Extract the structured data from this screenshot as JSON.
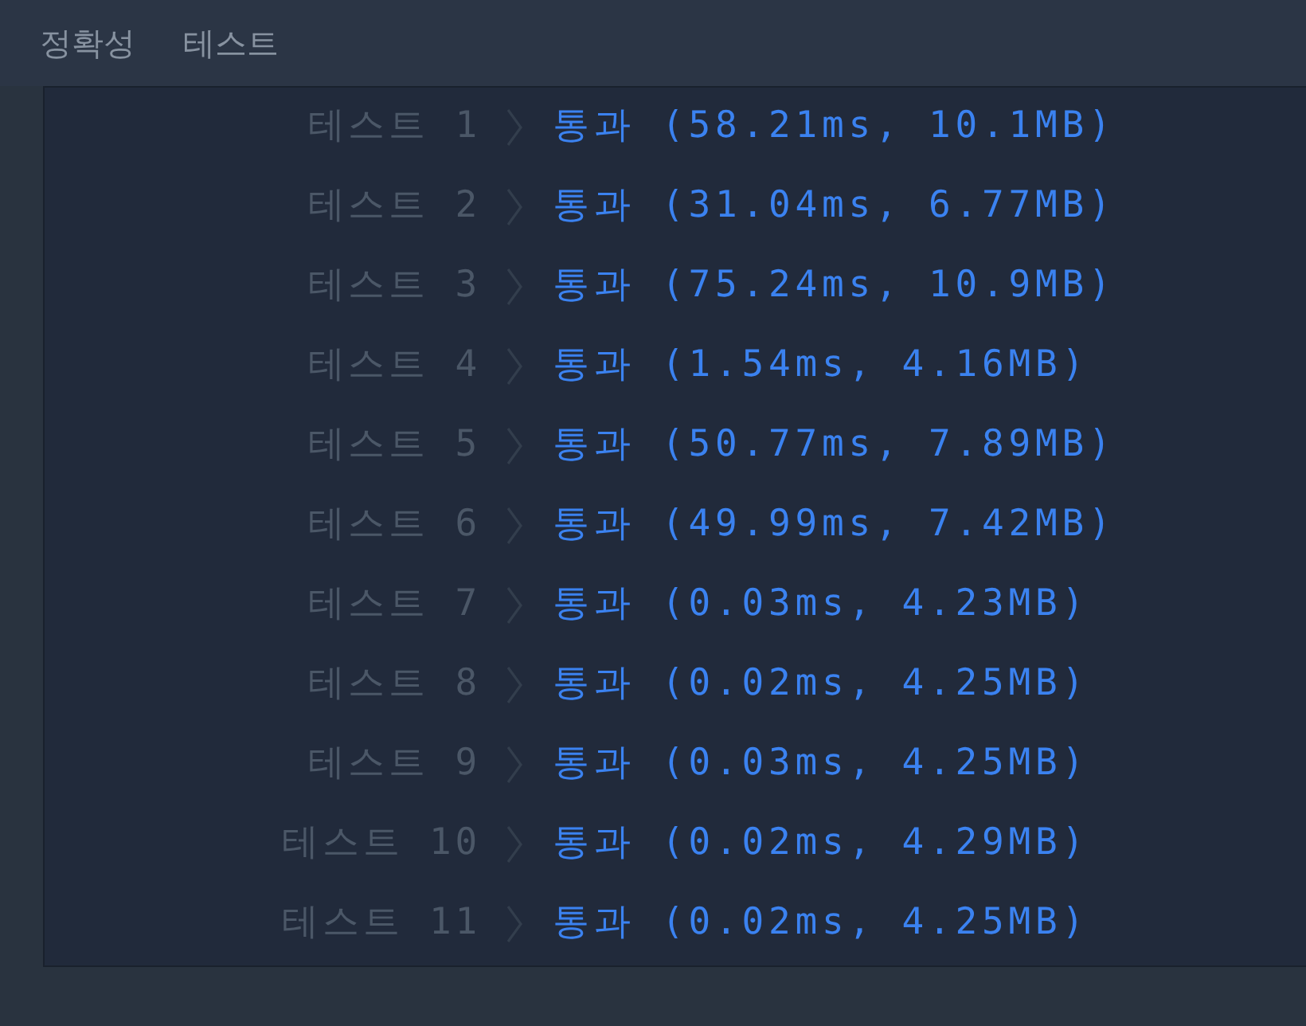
{
  "heading": {
    "category": "정확성",
    "title": "테스트"
  },
  "results": [
    {
      "test": "테스트 1",
      "result": "통과 (58.21ms, 10.1MB)"
    },
    {
      "test": "테스트 2",
      "result": "통과 (31.04ms, 6.77MB)"
    },
    {
      "test": "테스트 3",
      "result": "통과 (75.24ms, 10.9MB)"
    },
    {
      "test": "테스트 4",
      "result": "통과 (1.54ms, 4.16MB)"
    },
    {
      "test": "테스트 5",
      "result": "통과 (50.77ms, 7.89MB)"
    },
    {
      "test": "테스트 6",
      "result": "통과 (49.99ms, 7.42MB)"
    },
    {
      "test": "테스트 7",
      "result": "통과 (0.03ms, 4.23MB)"
    },
    {
      "test": "테스트 8",
      "result": "통과 (0.02ms, 4.25MB)"
    },
    {
      "test": "테스트 9",
      "result": "통과 (0.03ms, 4.25MB)"
    },
    {
      "test": "테스트 10",
      "result": "통과 (0.02ms, 4.29MB)"
    },
    {
      "test": "테스트 11",
      "result": "통과 (0.02ms, 4.25MB)"
    }
  ]
}
